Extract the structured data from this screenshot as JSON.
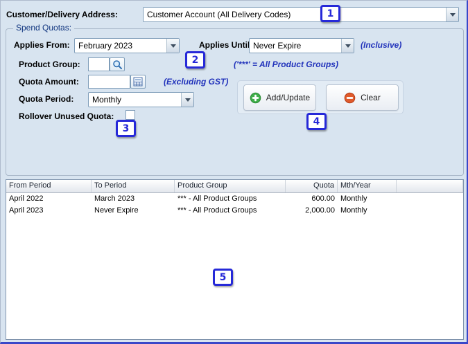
{
  "header": {
    "customer_address_label": "Customer/Delivery Address:",
    "customer_address_value": "Customer Account (All Delivery Codes)"
  },
  "spend_quotas": {
    "group_title": "Spend Quotas:",
    "applies_from": {
      "label": "Applies From:",
      "value": "February 2023"
    },
    "applies_until": {
      "label": "Applies Until:",
      "value": "Never Expire",
      "hint": "(Inclusive)"
    },
    "product_group": {
      "label": "Product Group:",
      "value": "",
      "hint": "('***' = All Product Groups)"
    },
    "quota_amount": {
      "label": "Quota Amount:",
      "value": "",
      "hint": "(Excluding GST)"
    },
    "quota_period": {
      "label": "Quota Period:",
      "value": "Monthly"
    },
    "rollover": {
      "label": "Rollover Unused Quota:",
      "checked": false
    },
    "buttons": {
      "add_update": "Add/Update",
      "clear": "Clear"
    }
  },
  "quota_table": {
    "columns": [
      "From Period",
      "To Period",
      "Product Group",
      "Quota",
      "Mth/Year"
    ],
    "rows": [
      [
        "April 2022",
        "March 2023",
        "*** - All Product Groups",
        "600.00",
        "Monthly"
      ],
      [
        "April 2023",
        "Never Expire",
        "*** - All Product Groups",
        "2,000.00",
        "Monthly"
      ]
    ]
  },
  "annotations": {
    "marks": [
      "1",
      "2",
      "3",
      "4",
      "5"
    ]
  },
  "colors": {
    "window_bg": "#d8e4f0",
    "hint_blue": "#2233bb",
    "annotation_blue": "#2629d8",
    "group_title_blue": "#10357f",
    "add_icon_green": "#3fae49",
    "clear_icon_red": "#e05a2b"
  }
}
